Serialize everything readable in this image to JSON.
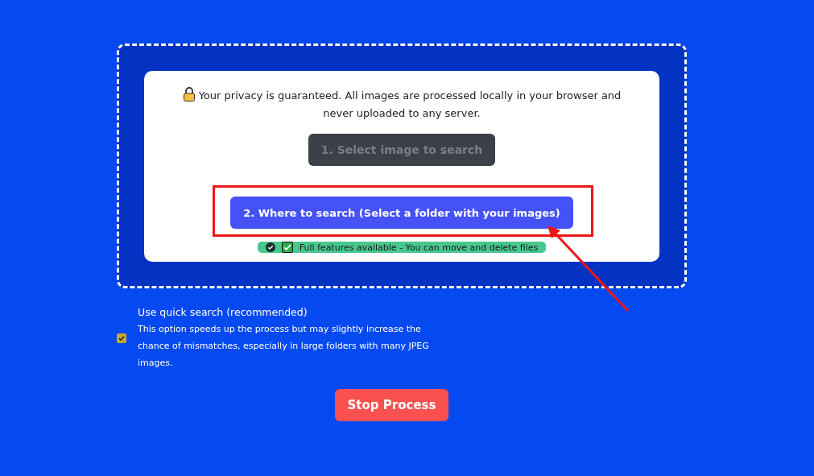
{
  "privacy_notice": "Your privacy is guaranteed. All images are processed locally in your browser and never uploaded to any server.",
  "buttons": [
    {
      "label": "1. Select image to search",
      "disabled": true,
      "highlighted": false
    },
    {
      "label": "2. Where to search (Select a folder with your images)",
      "disabled": false,
      "highlighted": true
    }
  ],
  "status_badge": "Full features available - You can move and delete files",
  "quick_search": {
    "label": "Use quick search (recommended)",
    "description": "This option speeds up the process but may slightly increase the chance of mismatches, especially in large folders with many JPEG images.",
    "checked": true
  },
  "stop_button": "Stop Process"
}
